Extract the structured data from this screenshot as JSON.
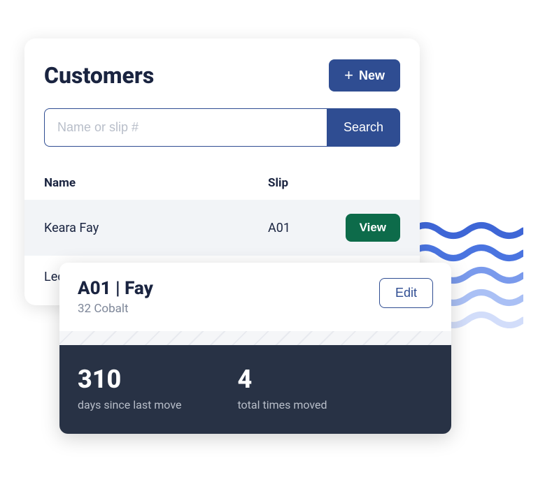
{
  "customers": {
    "title": "Customers",
    "new_label": "New",
    "search_placeholder": "Name or slip #",
    "search_button": "Search",
    "columns": {
      "name": "Name",
      "slip": "Slip"
    },
    "rows": [
      {
        "name": "Keara Fay",
        "slip": "A01",
        "action": "View"
      },
      {
        "name": "Leon",
        "slip": "",
        "action": ""
      }
    ]
  },
  "detail": {
    "title": "A01 | Fay",
    "subtitle": "32 Cobalt",
    "edit_label": "Edit",
    "stats": [
      {
        "value": "310",
        "label": "days since last move"
      },
      {
        "value": "4",
        "label": "total times moved"
      }
    ]
  }
}
